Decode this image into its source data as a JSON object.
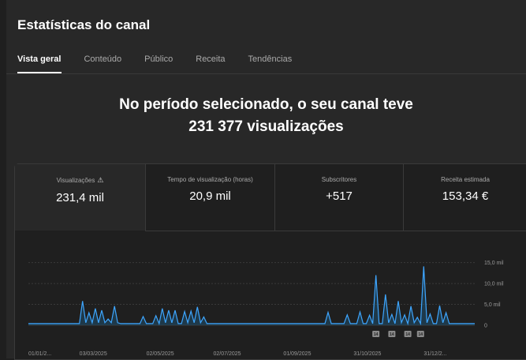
{
  "header": {
    "title": "Estatísticas do canal"
  },
  "tabs": [
    {
      "label": "Vista geral",
      "active": true
    },
    {
      "label": "Conteúdo"
    },
    {
      "label": "Público"
    },
    {
      "label": "Receita"
    },
    {
      "label": "Tendências"
    }
  ],
  "summary": {
    "line1": "No período selecionado, o seu canal teve",
    "line2": "231 377 visualizações"
  },
  "metrics": [
    {
      "label": "Visualizações",
      "value": "231,4 mil",
      "icon": "warning-icon"
    },
    {
      "label": "Tempo de visualização (horas)",
      "value": "20,9 mil"
    },
    {
      "label": "Subscritores",
      "value": "+517"
    },
    {
      "label": "Receita estimada",
      "value": "153,34 €"
    }
  ],
  "colors": {
    "line": "#3ea6ff",
    "area": "#1e4e6e",
    "background": "#1f1f1f"
  },
  "chart_data": {
    "type": "line",
    "x": [
      0,
      1,
      2,
      3,
      4,
      5,
      6,
      7,
      8,
      9,
      10,
      11,
      12,
      13,
      14,
      15,
      16,
      17,
      18,
      19,
      20,
      21,
      22,
      23,
      24,
      25,
      26,
      27,
      28,
      29,
      30,
      31,
      32,
      33,
      34,
      35,
      36,
      37,
      38,
      39,
      40,
      41,
      42,
      43,
      44,
      45,
      46,
      47,
      48,
      49,
      50,
      51,
      52,
      53,
      54,
      55,
      56,
      57,
      58,
      59,
      60,
      61,
      62,
      63,
      64,
      65,
      66,
      67,
      68,
      69,
      70,
      71,
      72,
      73,
      74,
      75,
      76,
      77,
      78,
      79,
      80,
      81,
      82,
      83,
      84,
      85,
      86,
      87,
      88,
      89,
      90,
      91,
      92,
      93,
      94,
      95,
      96,
      97,
      98,
      99,
      100,
      101,
      102,
      103,
      104,
      105,
      106,
      107,
      108,
      109,
      110,
      111,
      112,
      113,
      114,
      115,
      116,
      117,
      118,
      119,
      120,
      121,
      122,
      123,
      124,
      125,
      126,
      127,
      128,
      129,
      130,
      131,
      132,
      133,
      134,
      135,
      136,
      137,
      138,
      139,
      140
    ],
    "y": [
      0.4,
      0.4,
      0.4,
      0.4,
      0.4,
      0.4,
      0.4,
      0.4,
      0.4,
      0.4,
      0.4,
      0.4,
      0.4,
      0.4,
      0.4,
      0.4,
      0.4,
      5.8,
      0.6,
      3.0,
      0.6,
      4.0,
      0.6,
      3.6,
      0.6,
      1.5,
      0.6,
      4.6,
      0.6,
      0.4,
      0.4,
      0.4,
      0.4,
      0.4,
      0.4,
      0.4,
      2.1,
      0.4,
      0.4,
      0.4,
      2.3,
      0.4,
      4.0,
      0.6,
      3.6,
      0.6,
      3.6,
      0.4,
      0.4,
      3.3,
      0.6,
      3.4,
      0.6,
      4.4,
      0.6,
      2.0,
      0.4,
      0.4,
      0.4,
      0.4,
      0.4,
      0.4,
      0.4,
      0.4,
      0.4,
      0.4,
      0.4,
      0.4,
      0.4,
      0.4,
      0.4,
      0.4,
      0.4,
      0.4,
      0.4,
      0.4,
      0.4,
      0.4,
      0.4,
      0.4,
      0.4,
      0.4,
      0.4,
      0.4,
      0.4,
      0.4,
      0.4,
      0.4,
      0.4,
      0.4,
      0.4,
      0.4,
      0.4,
      0.4,
      3.1,
      0.4,
      0.4,
      0.4,
      0.4,
      0.4,
      2.5,
      0.4,
      0.4,
      0.4,
      3.2,
      0.4,
      0.4,
      2.4,
      0.4,
      12.0,
      0.4,
      0.4,
      7.4,
      0.6,
      2.6,
      0.4,
      5.8,
      0.6,
      2.5,
      0.4,
      4.6,
      0.6,
      1.9,
      0.4,
      14.1,
      0.6,
      2.7,
      0.4,
      0.4,
      4.7,
      0.6,
      3.0,
      0.4,
      0.4,
      0.4,
      0.4,
      0.4,
      0.4,
      0.4,
      0.4,
      0.4
    ],
    "yticks": [
      {
        "value": 15,
        "label": "15,0 mil"
      },
      {
        "value": 10,
        "label": "10,0 mil"
      },
      {
        "value": 5,
        "label": "5,0 mil"
      },
      {
        "value": 0,
        "label": "0"
      }
    ],
    "ylim": [
      0,
      15.5
    ],
    "xticks": [
      {
        "x": 0,
        "label": "01/01/2..."
      },
      {
        "x": 16,
        "label": "03/03/2025"
      },
      {
        "x": 37,
        "label": "02/05/2025"
      },
      {
        "x": 58,
        "label": "02/07/2025"
      },
      {
        "x": 80,
        "label": "01/09/2025"
      },
      {
        "x": 102,
        "label": "31/10/2025"
      },
      {
        "x": 124,
        "label": "31/12/2..."
      }
    ],
    "markers": [
      {
        "x": 109,
        "label": "14"
      },
      {
        "x": 114,
        "label": "14"
      },
      {
        "x": 119,
        "label": "14"
      },
      {
        "x": 123,
        "label": "14"
      }
    ]
  }
}
